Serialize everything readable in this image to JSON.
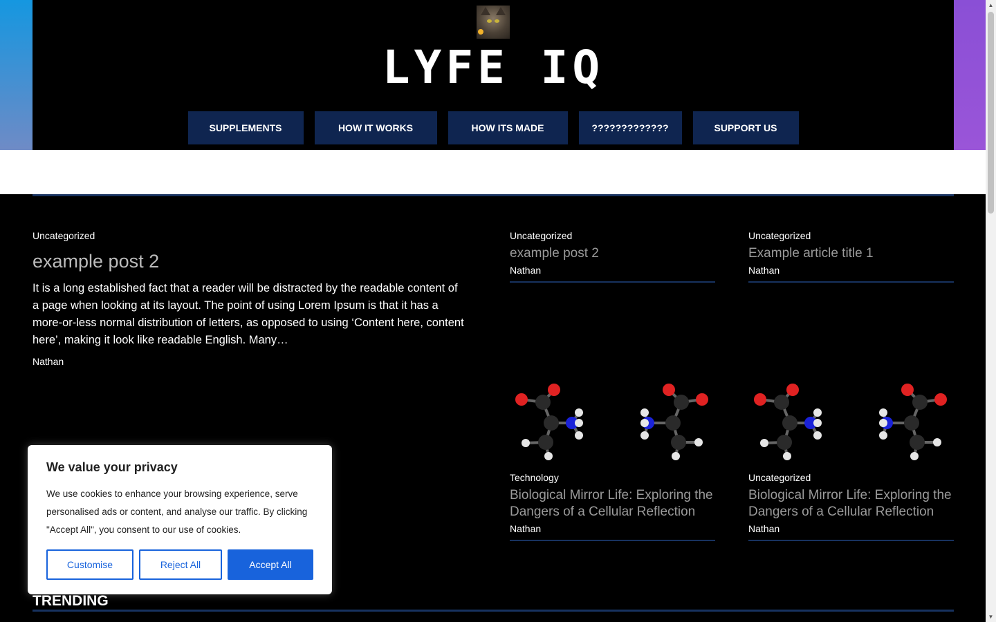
{
  "site": {
    "title": "LYFE IQ"
  },
  "nav": {
    "items": [
      {
        "label": "SUPPLEMENTS"
      },
      {
        "label": "HOW IT WORKS"
      },
      {
        "label": "HOW ITS MADE"
      },
      {
        "label": "?????????????"
      },
      {
        "label": "SUPPORT US"
      }
    ]
  },
  "featured": {
    "category": "Uncategorized",
    "title": "example post 2",
    "excerpt": "It is a long established fact that a reader will be distracted by the readable content of a page when looking at its layout. The point of using Lorem Ipsum is that it has a more-or-less normal distribution of letters, as opposed to using ‘Content here, content here’, making it look like readable English. Many…",
    "author": "Nathan"
  },
  "cards": [
    {
      "category": "Uncategorized",
      "title": "example post 2",
      "author": "Nathan"
    },
    {
      "category": "Uncategorized",
      "title": "Example article title 1",
      "author": "Nathan"
    },
    {
      "category": "Technology",
      "title": "Biological Mirror Life: Exploring the Dangers of a Cellular Reflection",
      "author": "Nathan"
    },
    {
      "category": "Uncategorized",
      "title": "Biological Mirror Life: Exploring the Dangers of a Cellular Reflection",
      "author": "Nathan"
    }
  ],
  "trending": {
    "label": "TRENDING"
  },
  "cookie": {
    "title": "We value your privacy",
    "text": "We use cookies to enhance your browsing experience, serve personalised ads or content, and analyse our traffic. By clicking \"Accept All\", you consent to our use of cookies.",
    "customise": "Customise",
    "reject": "Reject All",
    "accept": "Accept All"
  },
  "colors": {
    "nav_bg": "#0f2550",
    "divider": "#17325f",
    "accent_blue": "#1863dc",
    "grad_left": "#1597e0",
    "grad_right": "#8a4fd6",
    "atom_oxygen": "#e02222",
    "atom_carbon": "#2a2a2a",
    "atom_nitrogen": "#1a22d8",
    "atom_hydrogen": "#e6e6e6"
  }
}
